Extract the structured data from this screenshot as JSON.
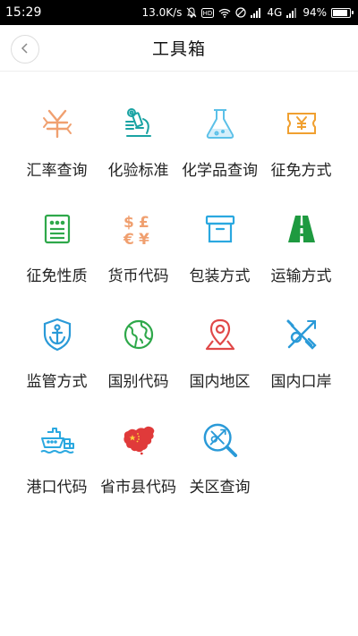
{
  "status_bar": {
    "time": "15:29",
    "net_speed": "13.0K/s",
    "network": "4G",
    "battery": "94%",
    "battery_level": 0.94
  },
  "header": {
    "title": "工具箱"
  },
  "tools": [
    {
      "label": "汇率查询",
      "icon": "yuan-exchange-icon",
      "color": "#f0a070"
    },
    {
      "label": "化验标准",
      "icon": "microscope-icon",
      "color": "#1aa3a3"
    },
    {
      "label": "化学品查询",
      "icon": "flask-icon",
      "color": "#5bc0e8"
    },
    {
      "label": "征免方式",
      "icon": "yuan-ticket-icon",
      "color": "#f0a030"
    },
    {
      "label": "征免性质",
      "icon": "document-list-icon",
      "color": "#2ea84a"
    },
    {
      "label": "货币代码",
      "icon": "currency-symbols-icon",
      "color": "#f0a070"
    },
    {
      "label": "包装方式",
      "icon": "box-icon",
      "color": "#2aa8e0"
    },
    {
      "label": "运输方式",
      "icon": "highway-icon",
      "color": "#1e9a40"
    },
    {
      "label": "监管方式",
      "icon": "shield-anchor-icon",
      "color": "#2a9ad8"
    },
    {
      "label": "国别代码",
      "icon": "globe-icon",
      "color": "#2ea84a"
    },
    {
      "label": "国内地区",
      "icon": "map-pin-icon",
      "color": "#e04848"
    },
    {
      "label": "国内口岸",
      "icon": "customs-emblem-icon",
      "color": "#2a9ad8"
    },
    {
      "label": "港口代码",
      "icon": "ship-icon",
      "color": "#2aa8e0"
    },
    {
      "label": "省市县代码",
      "icon": "china-map-icon",
      "color": "#e03a3a"
    },
    {
      "label": "关区查询",
      "icon": "search-emblem-icon",
      "color": "#2a9ad8"
    }
  ]
}
